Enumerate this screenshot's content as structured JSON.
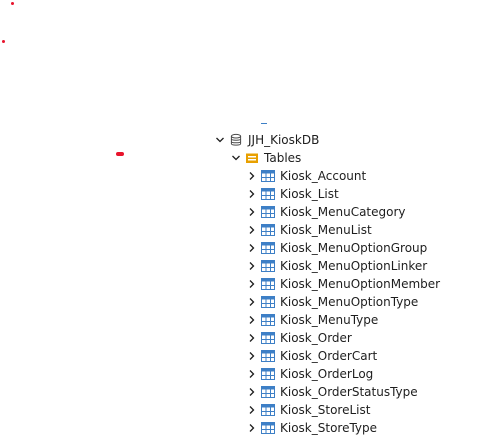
{
  "tree": {
    "database": {
      "label": "JJH_KioskDB",
      "expanded": true,
      "icon": "database-icon"
    },
    "tables_folder": {
      "label": "Tables",
      "expanded": true,
      "icon": "folder-icon",
      "icon_color": "#e8a000"
    },
    "tables": [
      {
        "label": "Kiosk_Account"
      },
      {
        "label": "Kiosk_List"
      },
      {
        "label": "Kiosk_MenuCategory"
      },
      {
        "label": "Kiosk_MenuList"
      },
      {
        "label": "Kiosk_MenuOptionGroup"
      },
      {
        "label": "Kiosk_MenuOptionLinker"
      },
      {
        "label": "Kiosk_MenuOptionMember"
      },
      {
        "label": "Kiosk_MenuOptionType"
      },
      {
        "label": "Kiosk_MenuType"
      },
      {
        "label": "Kiosk_Order"
      },
      {
        "label": "Kiosk_OrderCart"
      },
      {
        "label": "Kiosk_OrderLog"
      },
      {
        "label": "Kiosk_OrderStatusType"
      },
      {
        "label": "Kiosk_StoreList"
      },
      {
        "label": "Kiosk_StoreType"
      }
    ],
    "table_icon": "table-icon",
    "table_icon_color": "#3d7fc6"
  }
}
